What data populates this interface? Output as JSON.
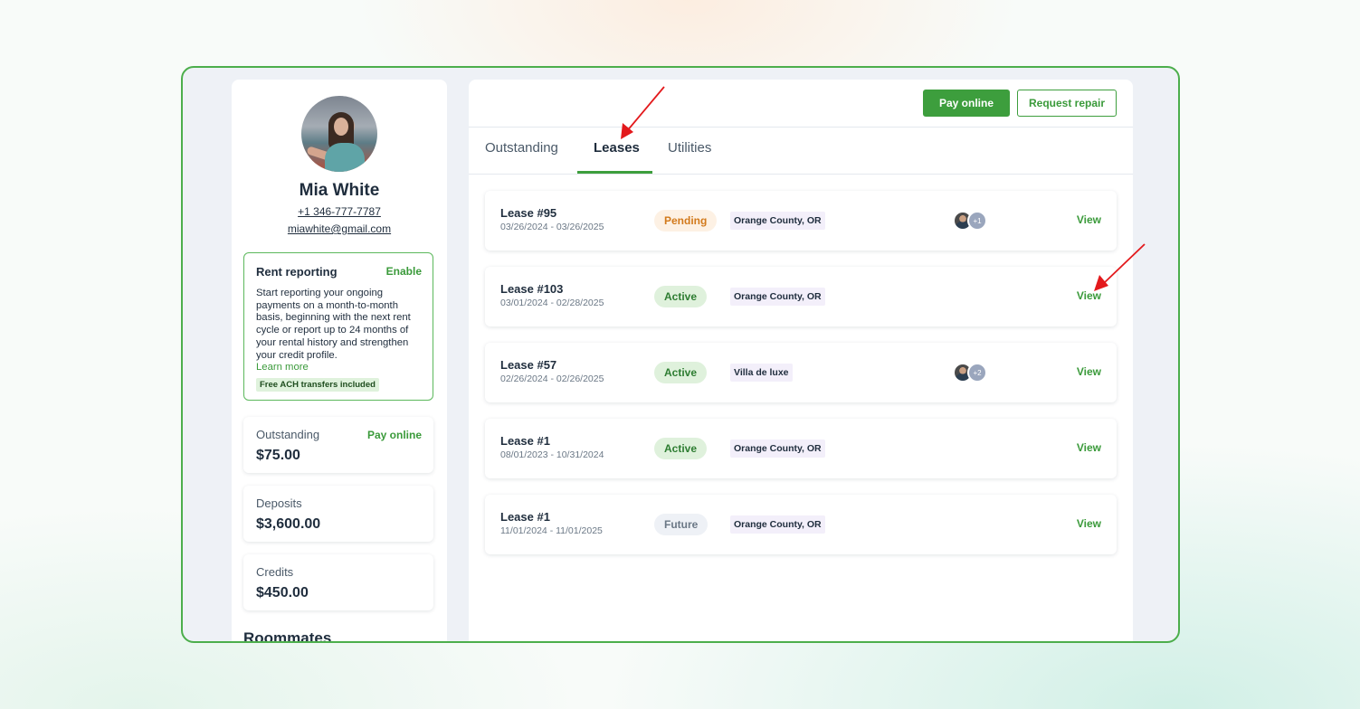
{
  "profile": {
    "name": "Mia White",
    "phone": "+1 346-777-7787",
    "email": "miawhite@gmail.com"
  },
  "rent_reporting": {
    "title": "Rent reporting",
    "action": "Enable",
    "description": "Start reporting your ongoing payments on a month-to-month basis, beginning with the next rent cycle or report up to 24 months of your rental history and strengthen your credit profile.",
    "learn_more": "Learn more",
    "badge": "Free ACH transfers included"
  },
  "stats": {
    "outstanding": {
      "label": "Outstanding",
      "value": "$75.00",
      "action": "Pay online"
    },
    "deposits": {
      "label": "Deposits",
      "value": "$3,600.00"
    },
    "credits": {
      "label": "Credits",
      "value": "$450.00"
    }
  },
  "roommates_title": "Roommates",
  "header": {
    "pay_online": "Pay online",
    "request_repair": "Request repair"
  },
  "tabs": [
    {
      "label": "Outstanding",
      "active": false
    },
    {
      "label": "Leases",
      "active": true
    },
    {
      "label": "Utilities",
      "active": false
    }
  ],
  "leases": [
    {
      "title": "Lease #95",
      "dates": "03/26/2024 - 03/26/2025",
      "status": "Pending",
      "status_type": "pending",
      "location": "Orange County, OR",
      "tenants_extra": "+1",
      "view": "View"
    },
    {
      "title": "Lease #103",
      "dates": "03/01/2024 - 02/28/2025",
      "status": "Active",
      "status_type": "active",
      "location": "Orange County, OR",
      "tenants_extra": "",
      "view": "View"
    },
    {
      "title": "Lease #57",
      "dates": "02/26/2024 - 02/26/2025",
      "status": "Active",
      "status_type": "active",
      "location": "Villa de luxe",
      "tenants_extra": "+2",
      "view": "View"
    },
    {
      "title": "Lease #1",
      "dates": "08/01/2023 - 10/31/2024",
      "status": "Active",
      "status_type": "active",
      "location": "Orange County, OR",
      "tenants_extra": "",
      "view": "View"
    },
    {
      "title": "Lease #1",
      "dates": "11/01/2024 - 11/01/2025",
      "status": "Future",
      "status_type": "future",
      "location": "Orange County, OR",
      "tenants_extra": "",
      "view": "View"
    }
  ],
  "colors": {
    "accent": "#3d9e3d",
    "frame_border": "#4cae4c",
    "annotation_arrow": "#e3191c"
  }
}
